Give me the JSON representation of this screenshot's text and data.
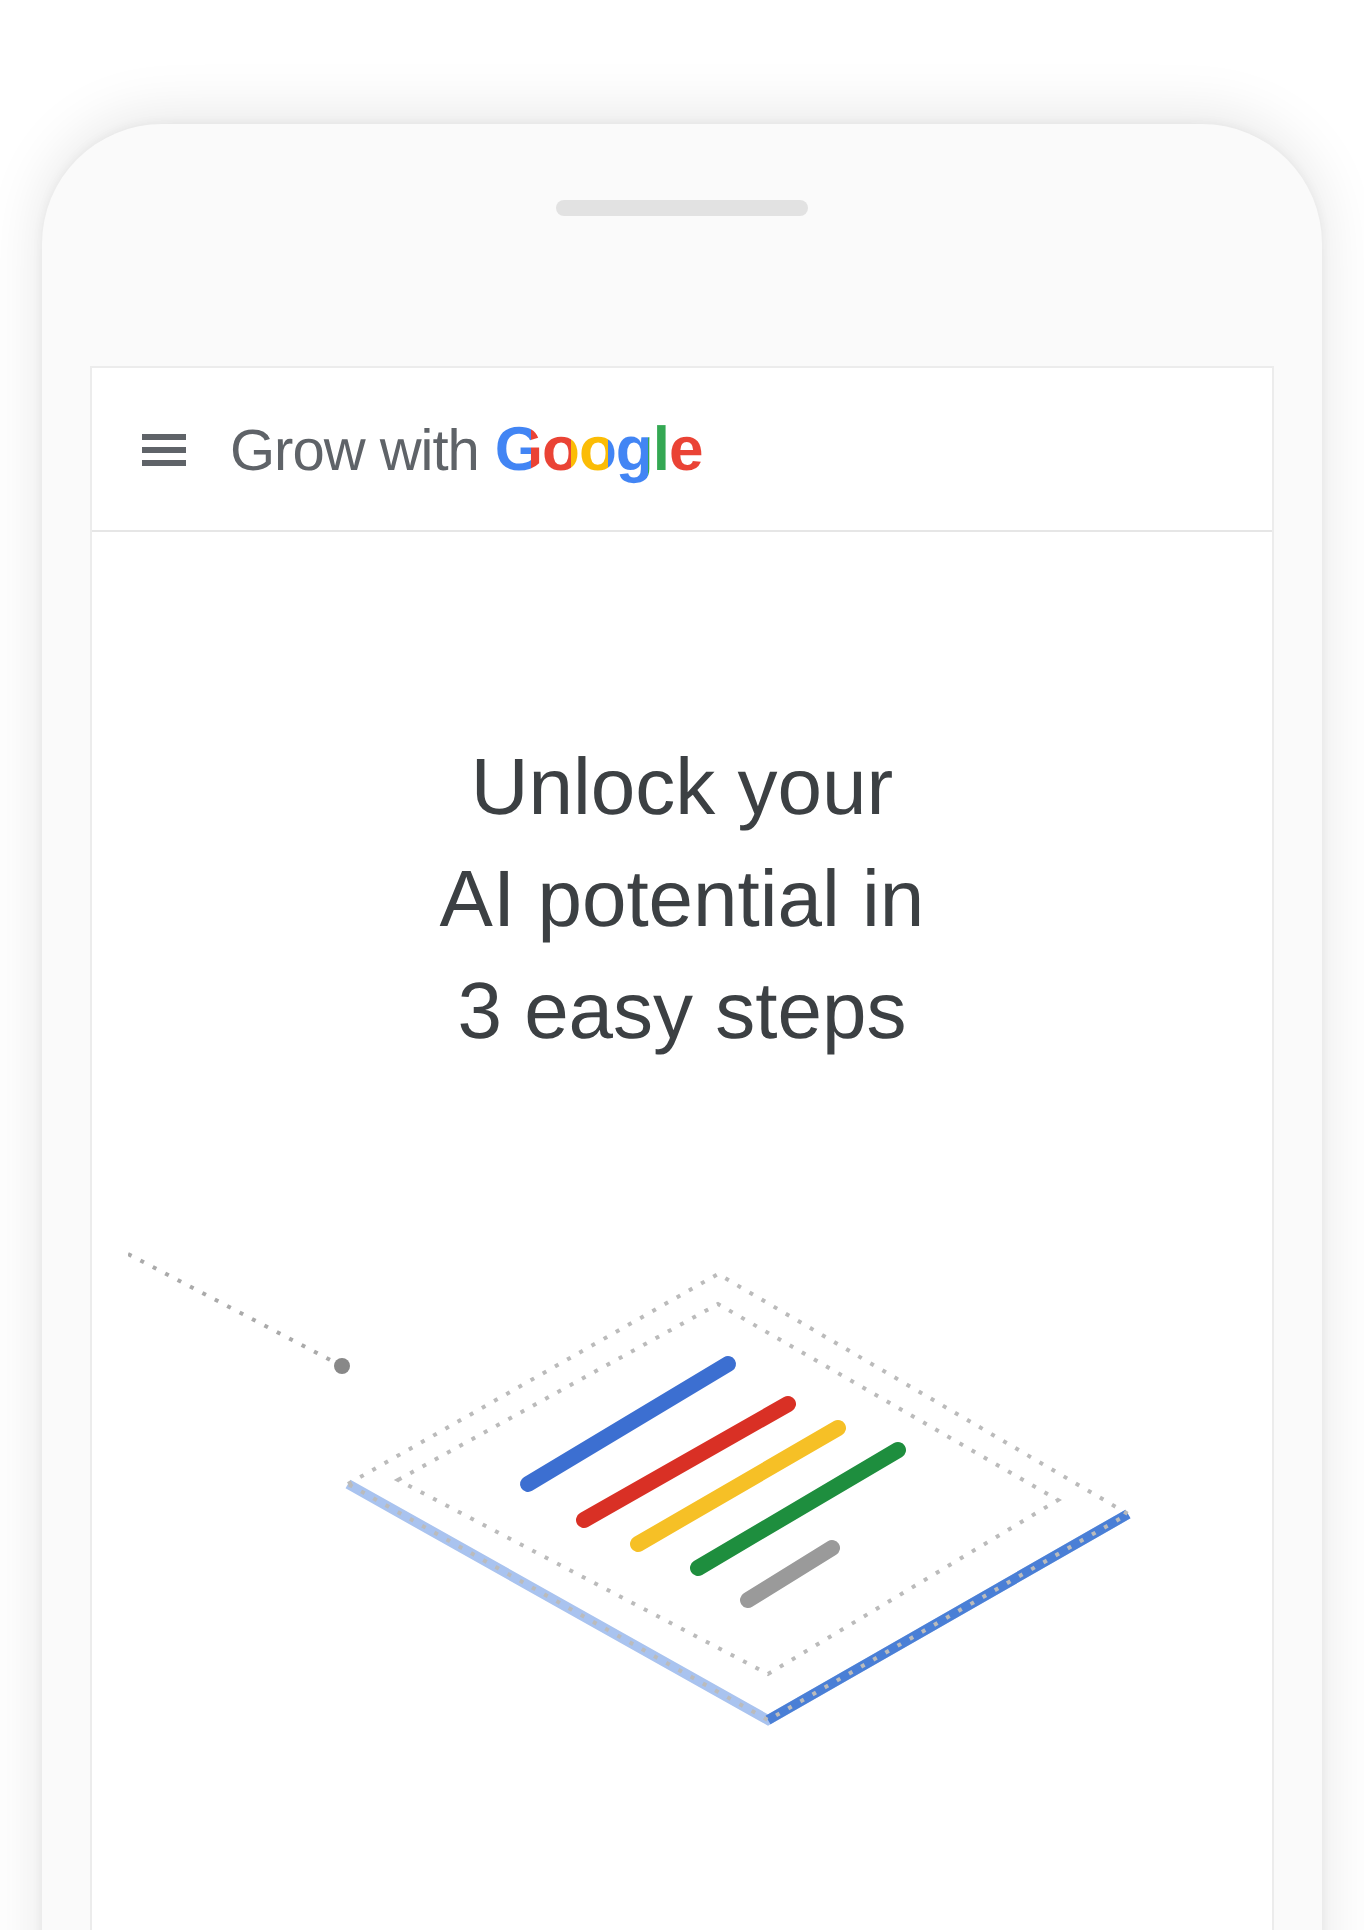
{
  "header": {
    "brand_prefix": "Grow with",
    "brand_name": "Google"
  },
  "hero": {
    "title_lines": [
      "Unlock your",
      "AI potential in",
      "3 easy steps"
    ]
  }
}
